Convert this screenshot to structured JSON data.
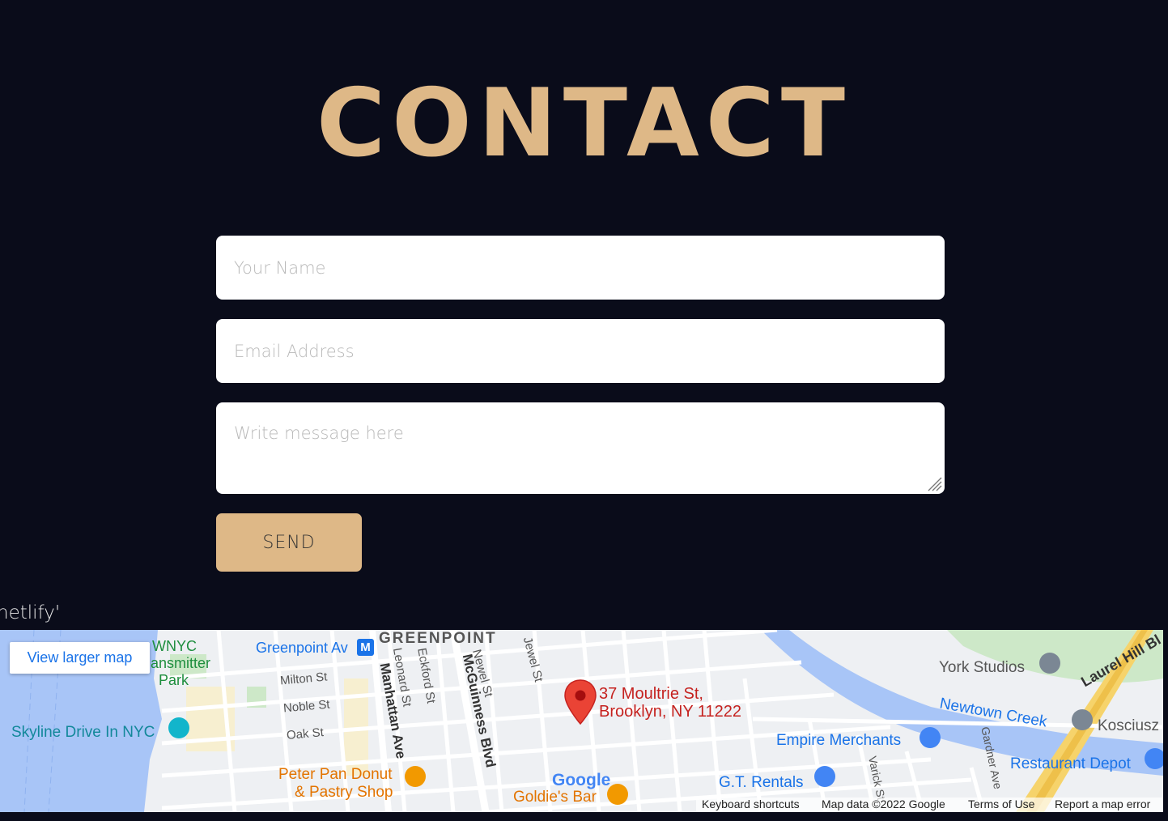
{
  "page_title": "CONTACT",
  "form": {
    "name_placeholder": "Your Name",
    "email_placeholder": "Email Address",
    "message_placeholder": "Write message here",
    "send_label": "SEND"
  },
  "netlify_text": "netlify'",
  "colors": {
    "background": "#0a0c1a",
    "accent": "#deb887"
  },
  "map": {
    "view_larger": "View larger map",
    "address_line1": "37 Moultrie St,",
    "address_line2": "Brooklyn, NY 11222",
    "labels": {
      "greenpoint": "GREENPOINT",
      "greenpoint_av": "Greenpoint Av",
      "wnyc1": "WNYC",
      "wnyc2": "ansmitter",
      "wnyc3": "Park",
      "milton": "Milton St",
      "noble": "Noble St",
      "oak": "Oak St",
      "manhattan": "Manhattan Ave",
      "leonard": "Leonard St",
      "eckford": "Eckford St",
      "mcguinness": "McGuinness Blvd",
      "newel": "Newel St",
      "jewel": "Jewel St",
      "skyline": "Skyline Drive In NYC",
      "peterpan1": "Peter Pan Donut",
      "peterpan2": "& Pastry Shop",
      "goldies": "Goldie's Bar",
      "york": "York Studios",
      "laurel": "Laurel Hill Bl",
      "newtown": "Newtown Creek",
      "kosciusz": "Kosciusz",
      "empire": "Empire Merchants",
      "gt": "G.T. Rentals",
      "restaurant": "Restaurant Depot",
      "gardner": "Gardner Ave",
      "varick": "Varick St",
      "google": "Google"
    },
    "footer": {
      "keyboard": "Keyboard shortcuts",
      "mapdata": "Map data ©2022 Google",
      "terms": "Terms of Use",
      "report": "Report a map error"
    }
  }
}
